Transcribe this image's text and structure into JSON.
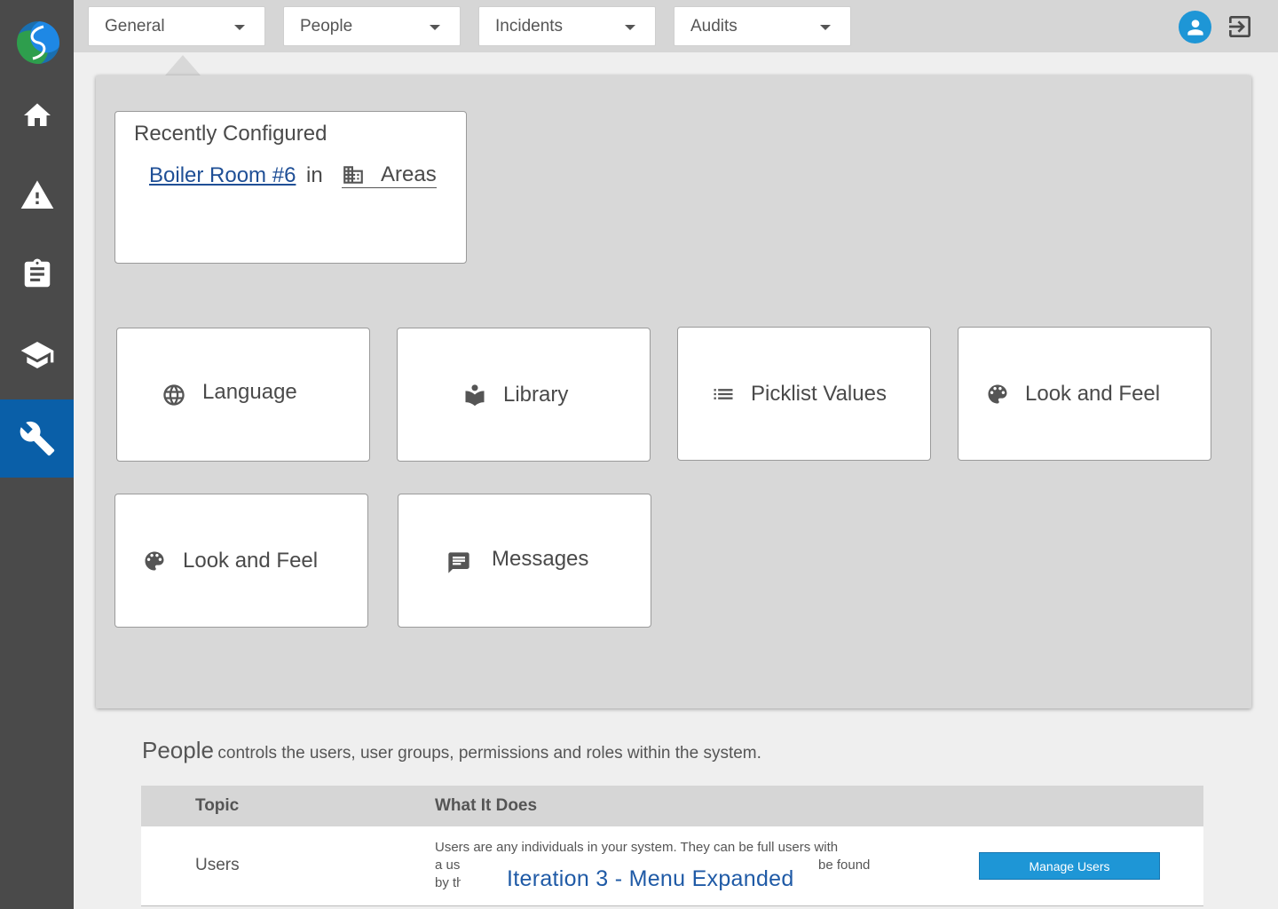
{
  "topbar": {
    "menus": [
      {
        "label": "General"
      },
      {
        "label": "People"
      },
      {
        "label": "Incidents"
      },
      {
        "label": "Audits"
      }
    ]
  },
  "sidebar": {
    "items": [
      {
        "icon": "home-icon"
      },
      {
        "icon": "warning-icon"
      },
      {
        "icon": "clipboard-icon"
      },
      {
        "icon": "graduation-cap-icon"
      },
      {
        "icon": "wrench-icon",
        "active": true
      }
    ]
  },
  "recent": {
    "title": "Recently Configured",
    "item": "Boiler Room #6",
    "in": "in",
    "area": "Areas"
  },
  "tiles": [
    {
      "label": "Language",
      "icon": "globe-icon"
    },
    {
      "label": "Library",
      "icon": "library-icon"
    },
    {
      "label": "Picklist Values",
      "icon": "list-icon"
    },
    {
      "label": "Look and Feel",
      "icon": "palette-icon"
    },
    {
      "label": "Look and Feel",
      "icon": "palette-icon"
    },
    {
      "label": "Messages",
      "icon": "message-icon"
    }
  ],
  "info": {
    "title": "People",
    "description": "controls the users, user groups, permissions and roles within the system."
  },
  "table": {
    "headers": [
      "Topic",
      "What It Does"
    ],
    "rows": [
      {
        "topic": "Users",
        "desc_line1": "Users are any individuals in your system. They can be full users with",
        "desc_line2": "a us",
        "desc_line2b": "be found",
        "desc_line3": "by th",
        "button": "Manage Users"
      }
    ]
  },
  "caption": "Iteration 3 - Menu Expanded",
  "colors": {
    "sidebar": "#4a4a4a",
    "active": "#0a5fa8",
    "accent": "#1e96d6",
    "link": "#1f4f96"
  }
}
